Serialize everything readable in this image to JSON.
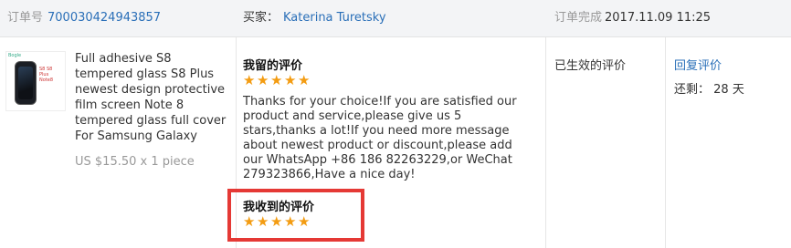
{
  "header": {
    "order_label": "订单号",
    "order_number": "700030424943857",
    "buyer_label": "买家：",
    "buyer_name": "Katerina Turetsky",
    "complete_label": "订单完成",
    "complete_time": "2017.11.09 11:25"
  },
  "product": {
    "title": "Full adhesive S8 tempered glass S8 Plus newest design protective film screen Note 8 tempered glass full cover For Samsung Galaxy",
    "price": "US $15.50 x 1 piece",
    "thumb_brand": "Bogle",
    "thumb_text": "S8 S8 Plus Note8"
  },
  "my_review": {
    "title": "我留的评价",
    "rating": 5,
    "text": "Thanks for your choice!If you are satisfied our product and service,please give us 5 stars,thanks a lot!If you need more message about newest product or discount,please add our WhatsApp +86 186 82263229,or WeChat 279323866,Have a nice day!"
  },
  "received_review": {
    "title": "我收到的评价",
    "rating": 5
  },
  "status": {
    "text": "已生效的评价"
  },
  "actions": {
    "reply_label": "回复评价",
    "remaining_label": "还剩：",
    "remaining_value": "28 天"
  },
  "colors": {
    "link": "#2a6fb8",
    "star": "#f39c12",
    "highlight": "#e53935"
  }
}
